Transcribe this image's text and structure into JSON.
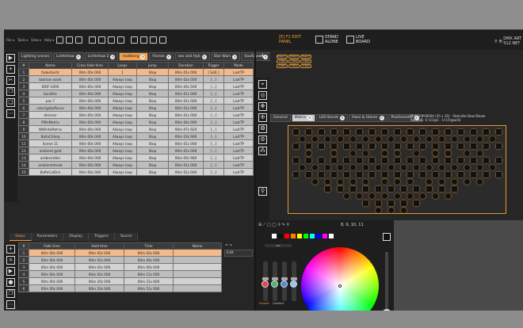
{
  "menubar": {
    "menus": [
      "File ▾",
      "Tools ▾",
      "View ▾",
      "Help ▾"
    ],
    "mode_edit": "EDIT\nPANEL",
    "mode_edit_key": "[E]",
    "mode_edit_key2": "F1",
    "mode_standalone": "STAND\nALONE",
    "mode_live": "LIVE\nBOARD",
    "right_info": "DMX ART\n512 NET"
  },
  "scene_tabs": [
    {
      "label": "Lighting scenes",
      "active": false
    },
    {
      "label": "Lichtshow",
      "active": false
    },
    {
      "label": "Lichtshow 2",
      "active": false
    },
    {
      "label": "mattberg",
      "active": true
    },
    {
      "label": "Florian",
      "active": false
    },
    {
      "label": "sex and Hyb",
      "active": false
    },
    {
      "label": "Star Wars",
      "active": false
    },
    {
      "label": "SoulShow",
      "active": false
    }
  ],
  "scene_table": {
    "columns": [
      "#",
      "Name",
      "Cross fade time",
      "Loops",
      "Jump",
      "Duration",
      "Trigger",
      "Mode"
    ],
    "rows": [
      [
        "1",
        "fadestarstr",
        "00m 00s 000",
        "1",
        "Stop",
        "00m 01s 000",
        "[ Edit ]",
        "LastTP"
      ],
      [
        "2",
        "batman wash",
        "00m 00s 000",
        "Always loop",
        "Stop",
        "00m 02s 000",
        "[...]",
        "LastTP"
      ],
      [
        "3",
        "WDF-2000",
        "00m 00s 000",
        "Always loop",
        "Stop",
        "00m 04s 500",
        "[...]",
        "LastTP"
      ],
      [
        "4",
        "backfire",
        "00m 00s 000",
        "Always loop",
        "Stop",
        "00m 01s 000",
        "[...]",
        "LastTP"
      ],
      [
        "5",
        "pos 7",
        "00m 00s 000",
        "Always loop",
        "Stop",
        "00m 01s 000",
        "[...]",
        "LastTP"
      ],
      [
        "6",
        "color/goboflocus",
        "00m 00s 000",
        "Always loop",
        "Stop",
        "00m 01s 000",
        "[...]",
        "LastTP"
      ],
      [
        "7",
        "dimmer",
        "00m 00s 000",
        "Always loop",
        "Stop",
        "00m 01s 000",
        "[...]",
        "LastTP"
      ],
      [
        "8",
        "PWnMatrix",
        "00m 00s 000",
        "Always loop",
        "Stop",
        "00m 04s 000",
        "[...]",
        "LastTP"
      ],
      [
        "9",
        "WWhiteMatrix",
        "00m 00s 000",
        "Always loop",
        "Stop",
        "00m 07s 920",
        "[...]",
        "LastTP"
      ],
      [
        "10",
        "BallaChSeq",
        "00m 00s 000",
        "Always loop",
        "Stop",
        "00m 03s 960",
        "[...]",
        "LastTP"
      ],
      [
        "11",
        "Scene 11",
        "00m 00s 000",
        "Always loop",
        "Stop",
        "00m 01s 000",
        "[...]",
        "LastTP"
      ],
      [
        "12",
        "ambient gold",
        "00m 00s 000",
        "Always loop",
        "Stop",
        "00m 01s 000",
        "[...]",
        "LastTP"
      ],
      [
        "13",
        "ambientdim",
        "00m 00s 000",
        "Always loop",
        "Stop",
        "00m 05s 960",
        "[...]",
        "LastTP"
      ],
      [
        "14",
        "ambientstrosb",
        "00m 00s 000",
        "Always loop",
        "Stop",
        "00m 01s 000",
        "[...]",
        "LastTP"
      ],
      [
        "15",
        "BaffeCalDim",
        "00m 00s 000",
        "Always loop",
        "Stop",
        "00m 01s 000",
        "[...]",
        "LastTP"
      ]
    ]
  },
  "lower_tabs": [
    {
      "label": "Steps",
      "active": true
    },
    {
      "label": "Parameters",
      "active": false
    },
    {
      "label": "Display",
      "active": false
    },
    {
      "label": "Triggers",
      "active": false
    },
    {
      "label": "Sound",
      "active": false
    }
  ],
  "steps_table": {
    "columns": [
      "#",
      "Fade time",
      "Hold time",
      "Time",
      "Name"
    ],
    "rows": [
      [
        "1",
        "00m 00s 000",
        "00m 02s 000",
        "00m 02s 000",
        ""
      ],
      [
        "2",
        "00m 00s 000",
        "00m 02s 000",
        "00m 04s 000",
        ""
      ],
      [
        "3",
        "00m 00s 000",
        "00m 02s 000",
        "00m 06s 000",
        ""
      ],
      [
        "4",
        "00m 00s 000",
        "00m 02s 000",
        "00m 11s 000",
        ""
      ],
      [
        "5",
        "00m 00s 000",
        "00m 20s 000",
        "00m 31s 000",
        ""
      ],
      [
        "6",
        "00m 00s 000",
        "00m 20s 000",
        "00m 51s 000",
        ""
      ]
    ]
  },
  "edit_col": {
    "label": "Edit"
  },
  "presets": [
    "Preset 1 1",
    "Preset 2",
    "Preset 3",
    "1 Wide",
    "2 Wide",
    "3 Wide",
    "4 Wide",
    "5 Wide",
    "6 Wide"
  ],
  "fixture_tabs": [
    {
      "label": "General",
      "active": false
    },
    {
      "label": "Matrix",
      "active": true
    },
    {
      "label": "LED Bands",
      "active": false
    },
    {
      "label": "Hans & Heiner",
      "active": false
    },
    {
      "label": "Positionsetc",
      "active": false
    }
  ],
  "matrix_info": {
    "line1": "Matrix #00004 (35 x 16) - Stairville Bowl Beam",
    "line2": "Address: U:1(1@1 - U:1/5@ac6)"
  },
  "color_panel": {
    "title": "8, 9, 10, 11",
    "fader_label": "calc",
    "bottom_tabs": [
      "Presets",
      "Content"
    ],
    "swatches": [
      "#ffffff",
      "#111111",
      "#ff0000",
      "#ff8000",
      "#ffff00",
      "#00ff00",
      "#00ffff",
      "#0000ff",
      "#ff00ff",
      "#ffffff"
    ]
  }
}
